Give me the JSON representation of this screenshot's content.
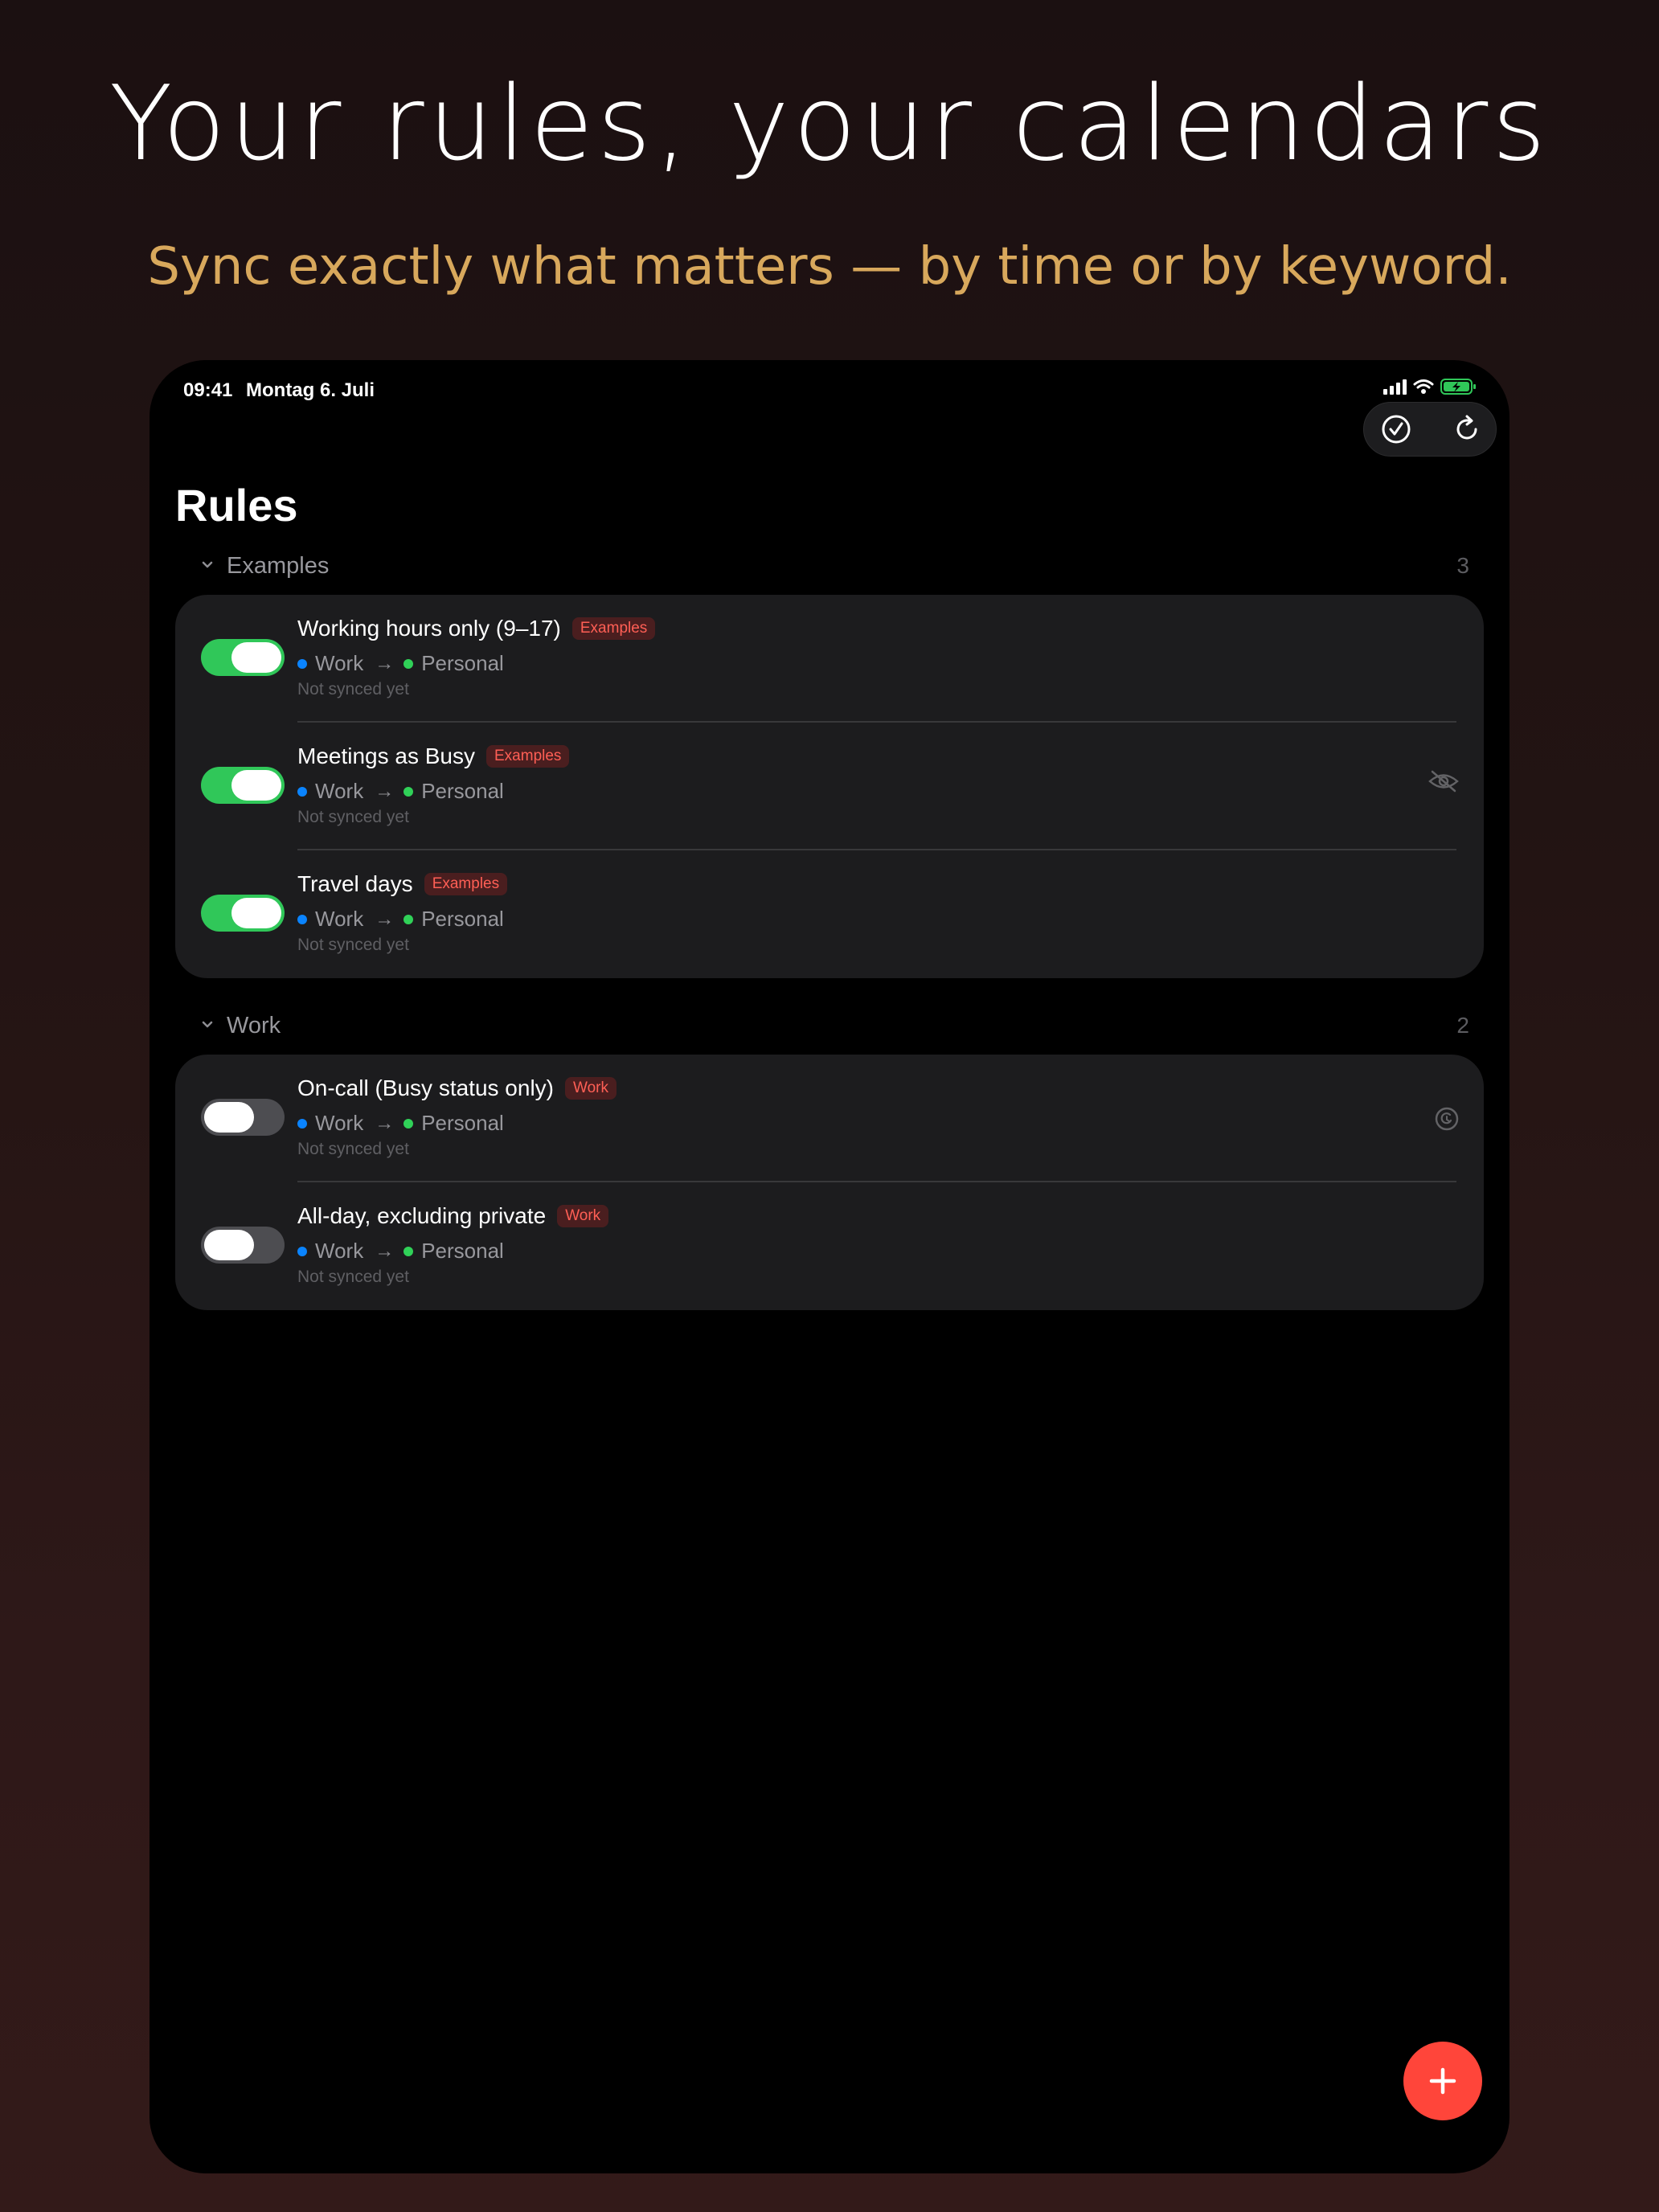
{
  "hero": {
    "headline": "Your rules, your calendars",
    "subline": "Sync exactly what matters — by time or by keyword."
  },
  "status_bar": {
    "time": "09:41",
    "date": "Montag 6. Juli",
    "icons": [
      "cellular-signal-icon",
      "wifi-icon",
      "battery-charging-icon"
    ]
  },
  "toolbar": {
    "buttons": [
      "checkmark-circle-icon",
      "refresh-icon"
    ]
  },
  "page": {
    "title": "Rules"
  },
  "sections": [
    {
      "name": "Examples",
      "count": "3",
      "rules": [
        {
          "name": "Working hours only (9–17)",
          "tag": "Examples",
          "enabled": true,
          "source": "Work",
          "target": "Personal",
          "status": "Not synced yet",
          "trailing_icon": null
        },
        {
          "name": "Meetings as Busy",
          "tag": "Examples",
          "enabled": true,
          "source": "Work",
          "target": "Personal",
          "status": "Not synced yet",
          "trailing_icon": "eye-slash-icon"
        },
        {
          "name": "Travel days",
          "tag": "Examples",
          "enabled": true,
          "source": "Work",
          "target": "Personal",
          "status": "Not synced yet",
          "trailing_icon": null
        }
      ]
    },
    {
      "name": "Work",
      "count": "2",
      "rules": [
        {
          "name": "On-call (Busy status only)",
          "tag": "Work",
          "enabled": false,
          "source": "Work",
          "target": "Personal",
          "status": "Not synced yet",
          "trailing_icon": "history-icon"
        },
        {
          "name": "All-day, excluding private",
          "tag": "Work",
          "enabled": false,
          "source": "Work",
          "target": "Personal",
          "status": "Not synced yet",
          "trailing_icon": null
        }
      ]
    }
  ],
  "colors": {
    "accent_red": "#ff453a",
    "toggle_on": "#30c759",
    "source_calendar": "#0a84ff",
    "target_calendar": "#30d158",
    "subline_gold": "#d8a85c"
  },
  "fab": {
    "icon": "plus-icon"
  }
}
